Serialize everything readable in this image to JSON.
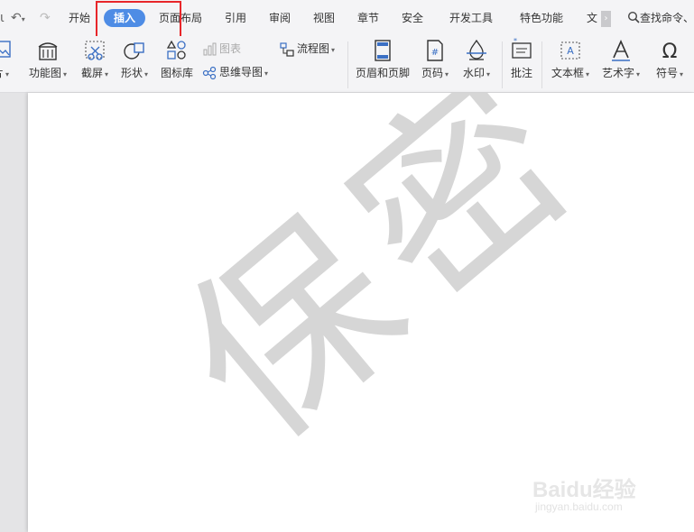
{
  "tabs": [
    {
      "label": "开始"
    },
    {
      "label": "插入"
    },
    {
      "label": "页面布局"
    },
    {
      "label": "引用"
    },
    {
      "label": "审阅"
    },
    {
      "label": "视图"
    },
    {
      "label": "章节"
    },
    {
      "label": "安全"
    },
    {
      "label": "开发工具"
    },
    {
      "label": "特色功能"
    },
    {
      "label": "文"
    }
  ],
  "active_tab": "插入",
  "search": {
    "label": "查找命令、"
  },
  "ribbon": {
    "picture": "片",
    "function_chart": "功能图",
    "screenshot": "截屏",
    "shape": "形状",
    "icon_library": "图标库",
    "chart": "图表",
    "mind_map": "思维导图",
    "flowchart": "流程图",
    "header_footer": "页眉和页脚",
    "page_number": "页码",
    "watermark": "水印",
    "comment": "批注",
    "text_box": "文本框",
    "word_art": "艺术字",
    "symbol": "符号"
  },
  "document": {
    "watermark_text": "保密"
  },
  "branding": {
    "logo_text": "Baidu经验",
    "url": "jingyan.baidu.com"
  },
  "colors": {
    "active_tab_bg": "#4e8ce5",
    "highlight": "#e8262a",
    "watermark": "#d6d6d6"
  }
}
